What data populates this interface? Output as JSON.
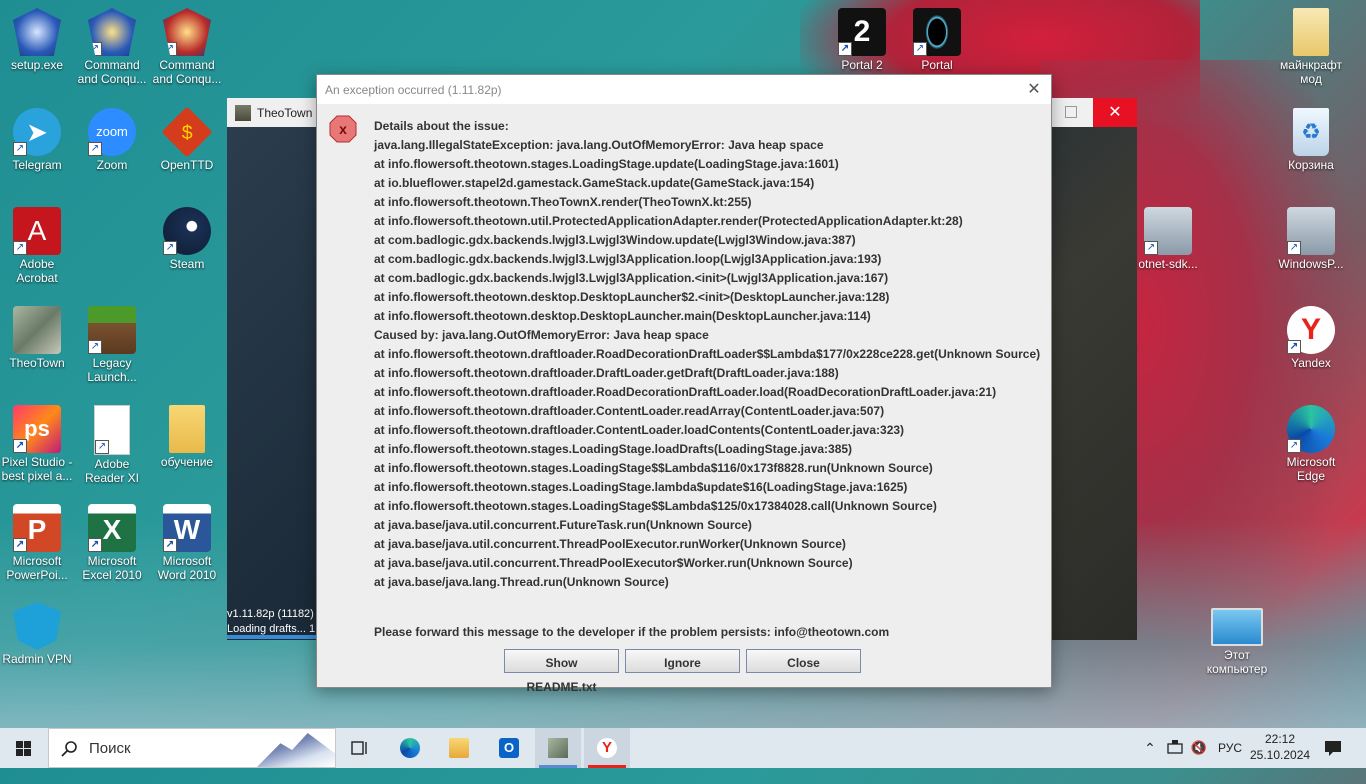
{
  "desktop": {
    "left_icons": [
      {
        "label": "setup.exe",
        "icon": "setup-shield-icon"
      },
      {
        "label": "Command and Conqu...",
        "icon": "cnc-shield-icon"
      },
      {
        "label": "Command and Conqu...",
        "icon": "cnc-shield-icon"
      },
      {
        "label": "Telegram",
        "icon": "telegram-icon"
      },
      {
        "label": "Zoom",
        "icon": "zoom-icon"
      },
      {
        "label": "OpenTTD",
        "icon": "openttd-icon"
      },
      {
        "label": "Adobe Acrobat",
        "icon": "acrobat-icon"
      },
      {
        "label": "Steam",
        "icon": "steam-icon"
      },
      {
        "label": "TheoTown",
        "icon": "theotown-icon"
      },
      {
        "label": "Legacy Launch...",
        "icon": "minecraft-icon"
      },
      {
        "label": "Pixel Studio - best pixel a...",
        "icon": "pixel-studio-icon"
      },
      {
        "label": "Adobe Reader XI",
        "icon": "document-icon"
      },
      {
        "label": "обучение",
        "icon": "folder-icon"
      },
      {
        "label": "Microsoft PowerPoi...",
        "icon": "powerpoint-icon"
      },
      {
        "label": "Microsoft Excel 2010",
        "icon": "excel-icon"
      },
      {
        "label": "Microsoft Word 2010",
        "icon": "word-icon"
      },
      {
        "label": "Radmin VPN",
        "icon": "radmin-vpn-icon"
      }
    ],
    "top_icons": [
      {
        "label": "Portal 2",
        "icon": "portal2-icon"
      },
      {
        "label": "Portal",
        "icon": "portal-icon"
      }
    ],
    "right_icons": [
      {
        "label": "майнкрафт мод",
        "icon": "folder-icon"
      },
      {
        "label": "Корзина",
        "icon": "recycle-bin-icon"
      },
      {
        "label": "otnet-sdk...",
        "icon": "installer-icon"
      },
      {
        "label": "WindowsP...",
        "icon": "installer-icon"
      },
      {
        "label": "Yandex",
        "icon": "yandex-icon"
      },
      {
        "label": "Microsoft Edge",
        "icon": "edge-icon"
      },
      {
        "label": "Этот компьютер",
        "icon": "computer-icon"
      }
    ]
  },
  "game_window": {
    "title": "TheoTown",
    "version": "v1.11.82p (11182)",
    "loading": "Loading drafts... 1"
  },
  "dialog": {
    "title": "An exception occurred (1.11.82p)",
    "lines": [
      "Details about the issue:",
      "java.lang.IllegalStateException: java.lang.OutOfMemoryError: Java heap space",
      "at info.flowersoft.theotown.stages.LoadingStage.update(LoadingStage.java:1601)",
      "at io.blueflower.stapel2d.gamestack.GameStack.update(GameStack.java:154)",
      "at info.flowersoft.theotown.TheoTownX.render(TheoTownX.kt:255)",
      "at info.flowersoft.theotown.util.ProtectedApplicationAdapter.render(ProtectedApplicationAdapter.kt:28)",
      "at com.badlogic.gdx.backends.lwjgl3.Lwjgl3Window.update(Lwjgl3Window.java:387)",
      "at com.badlogic.gdx.backends.lwjgl3.Lwjgl3Application.loop(Lwjgl3Application.java:193)",
      "at com.badlogic.gdx.backends.lwjgl3.Lwjgl3Application.<init>(Lwjgl3Application.java:167)",
      "at info.flowersoft.theotown.desktop.DesktopLauncher$2.<init>(DesktopLauncher.java:128)",
      "at info.flowersoft.theotown.desktop.DesktopLauncher.main(DesktopLauncher.java:114)",
      "Caused by: java.lang.OutOfMemoryError: Java heap space",
      "at info.flowersoft.theotown.draftloader.RoadDecorationDraftLoader$$Lambda$177/0x228ce228.get(Unknown Source)",
      "at info.flowersoft.theotown.draftloader.DraftLoader.getDraft(DraftLoader.java:188)",
      "at info.flowersoft.theotown.draftloader.RoadDecorationDraftLoader.load(RoadDecorationDraftLoader.java:21)",
      "at info.flowersoft.theotown.draftloader.ContentLoader.readArray(ContentLoader.java:507)",
      "at info.flowersoft.theotown.draftloader.ContentLoader.loadContents(ContentLoader.java:323)",
      "at info.flowersoft.theotown.stages.LoadingStage.loadDrafts(LoadingStage.java:385)",
      "at info.flowersoft.theotown.stages.LoadingStage$$Lambda$116/0x173f8828.run(Unknown Source)",
      "at info.flowersoft.theotown.stages.LoadingStage.lambda$update$16(LoadingStage.java:1625)",
      "at info.flowersoft.theotown.stages.LoadingStage$$Lambda$125/0x17384028.call(Unknown Source)",
      "at java.base/java.util.concurrent.FutureTask.run(Unknown Source)",
      "at java.base/java.util.concurrent.ThreadPoolExecutor.runWorker(Unknown Source)",
      "at java.base/java.util.concurrent.ThreadPoolExecutor$Worker.run(Unknown Source)",
      "at java.base/java.lang.Thread.run(Unknown Source)"
    ],
    "forward_message": "Please forward this message to the developer if the problem persists: info@theotown.com",
    "buttons": {
      "readme": "Show README.txt",
      "ignore": "Ignore",
      "close": "Close"
    }
  },
  "taskbar": {
    "search_placeholder": "Поиск",
    "language": "РУС",
    "time": "22:12",
    "date": "25.10.2024"
  }
}
